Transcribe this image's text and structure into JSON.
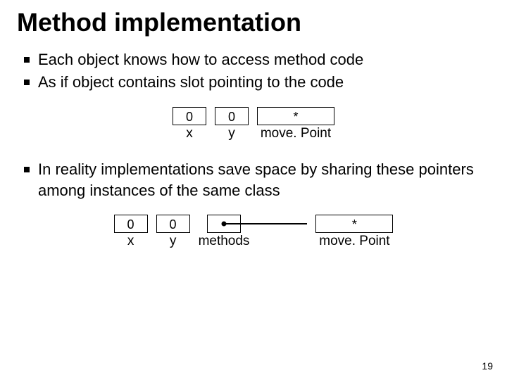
{
  "title": "Method implementation",
  "bullets_top": [
    "Each object knows how to access method code",
    "As if object contains slot pointing to the code"
  ],
  "bullets_bottom": [
    "In reality implementations save space by sharing these pointers among instances of the same class"
  ],
  "diagram1": {
    "c0_top": "0",
    "c0_bot": "x",
    "c1_top": "0",
    "c1_bot": "y",
    "c2_top": "*",
    "c2_bot": "move. Point"
  },
  "diagram2": {
    "c0_top": "0",
    "c0_bot": "x",
    "c1_top": "0",
    "c1_bot": "y",
    "c2_bot": "methods",
    "c3_top": "*",
    "c3_bot": "move. Point"
  },
  "page_number": "19"
}
